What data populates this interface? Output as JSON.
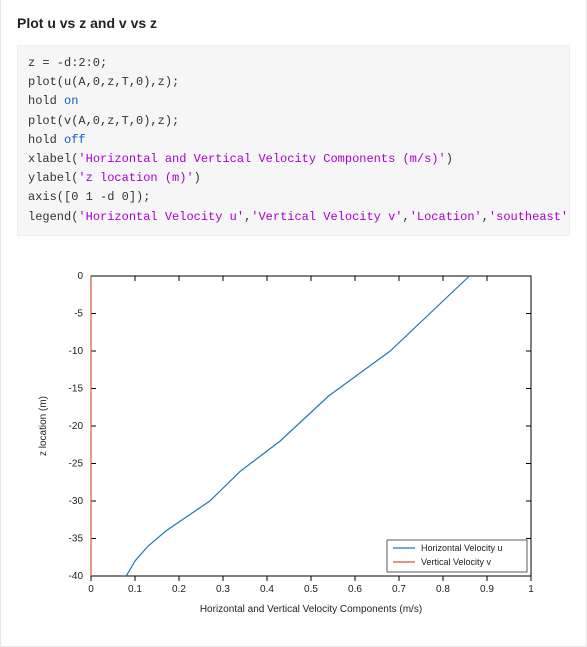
{
  "title": "Plot u vs z and v vs z",
  "code": {
    "l1": "z = -d:2:0;",
    "l2a": "plot(u(A,0,z,T,0),z);",
    "l3a": "hold ",
    "l3b": "on",
    "l4a": "plot(v(A,0,z,T,0),z);",
    "l5a": "hold ",
    "l5b": "off",
    "l6a": "xlabel(",
    "l6b": "'Horizontal and Vertical Velocity Components (m/s)'",
    "l6c": ")",
    "l7a": "ylabel(",
    "l7b": "'z location (m)'",
    "l7c": ")",
    "l8": "axis([0 1 -d 0]);",
    "l9a": "legend(",
    "l9b": "'Horizontal Velocity u'",
    "l9c": ",",
    "l9d": "'Vertical Velocity v'",
    "l9e": ",",
    "l9f": "'Location'",
    "l9g": ",",
    "l9h": "'southeast'",
    "l9i": ")"
  },
  "chart_data": {
    "type": "line",
    "title": "",
    "xlabel": "Horizontal and Vertical Velocity Components (m/s)",
    "ylabel": "z location (m)",
    "xlim": [
      0,
      1
    ],
    "ylim": [
      -40,
      0
    ],
    "xticks": [
      0,
      0.1,
      0.2,
      0.3,
      0.4,
      0.5,
      0.6,
      0.7,
      0.8,
      0.9,
      1
    ],
    "yticks": [
      0,
      -5,
      -10,
      -15,
      -20,
      -25,
      -30,
      -35,
      -40
    ],
    "series": [
      {
        "name": "Horizontal Velocity u",
        "color": "#1f77b4",
        "x": [
          0.08,
          0.1,
          0.13,
          0.17,
          0.22,
          0.27,
          0.34,
          0.43,
          0.54,
          0.68,
          0.86
        ],
        "y": [
          -40,
          -38,
          -36,
          -34,
          -32,
          -30,
          -26,
          -22,
          -16,
          -10,
          0
        ]
      },
      {
        "name": "Vertical Velocity v",
        "color": "#d6543a",
        "x": [
          0.0,
          0.0
        ],
        "y": [
          0,
          -40
        ]
      }
    ],
    "legend": {
      "position": "southeast",
      "entries": [
        "Horizontal Velocity u",
        "Vertical Velocity v"
      ]
    }
  }
}
